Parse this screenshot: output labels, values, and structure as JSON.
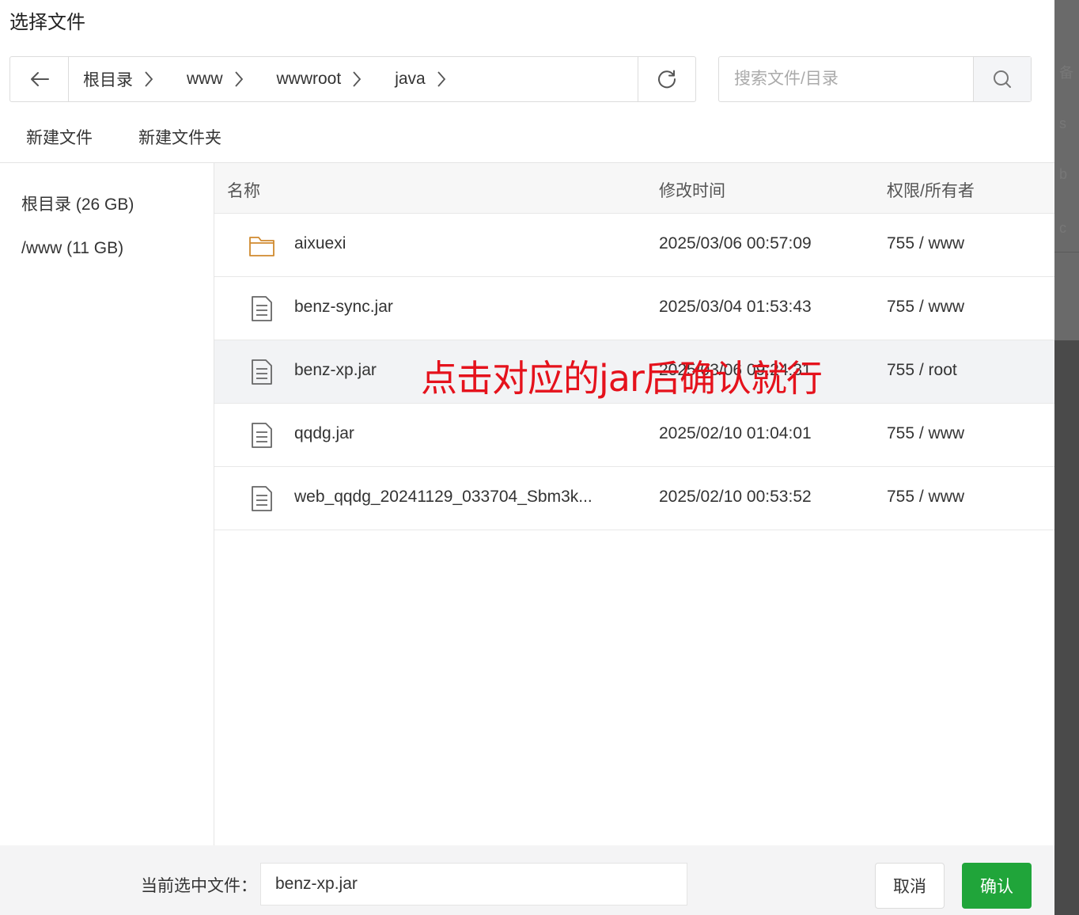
{
  "dialog": {
    "title": "选择文件"
  },
  "breadcrumb": [
    {
      "label": "根目录"
    },
    {
      "label": "www"
    },
    {
      "label": "wwwroot"
    },
    {
      "label": "java"
    }
  ],
  "search": {
    "placeholder": "搜索文件/目录"
  },
  "toolbar": {
    "new_file": "新建文件",
    "new_folder": "新建文件夹"
  },
  "sidebar": {
    "items": [
      {
        "label": "根目录 (26 GB)"
      },
      {
        "label": "/www (11 GB)"
      }
    ]
  },
  "table": {
    "headers": {
      "name": "名称",
      "time": "修改时间",
      "perm": "权限/所有者"
    },
    "rows": [
      {
        "icon": "folder-icon",
        "name": "aixuexi",
        "time": "2025/03/06 00:57:09",
        "perm": "755 / www"
      },
      {
        "icon": "file-icon",
        "name": "benz-sync.jar",
        "time": "2025/03/04 01:53:43",
        "perm": "755 / www"
      },
      {
        "icon": "file-icon",
        "name": "benz-xp.jar",
        "time": "2025/03/06 09:24:31",
        "perm": "755 / root"
      },
      {
        "icon": "file-icon",
        "name": "qqdg.jar",
        "time": "2025/02/10 01:04:01",
        "perm": "755 / www"
      },
      {
        "icon": "file-icon",
        "name": "web_qqdg_20241129_033704_Sbm3k...",
        "time": "2025/02/10 00:53:52",
        "perm": "755 / www"
      }
    ]
  },
  "annotation": {
    "text": "点击对应的jar后确认就行",
    "color": "#e5121c"
  },
  "footer": {
    "label": "当前选中文件：",
    "selected": "benz-xp.jar",
    "cancel": "取消",
    "confirm": "确认"
  },
  "colors": {
    "accent": "#20a53a",
    "folder": "#d08a2e"
  },
  "background": {
    "texts": [
      "备",
      "s",
      "b",
      "c"
    ]
  }
}
